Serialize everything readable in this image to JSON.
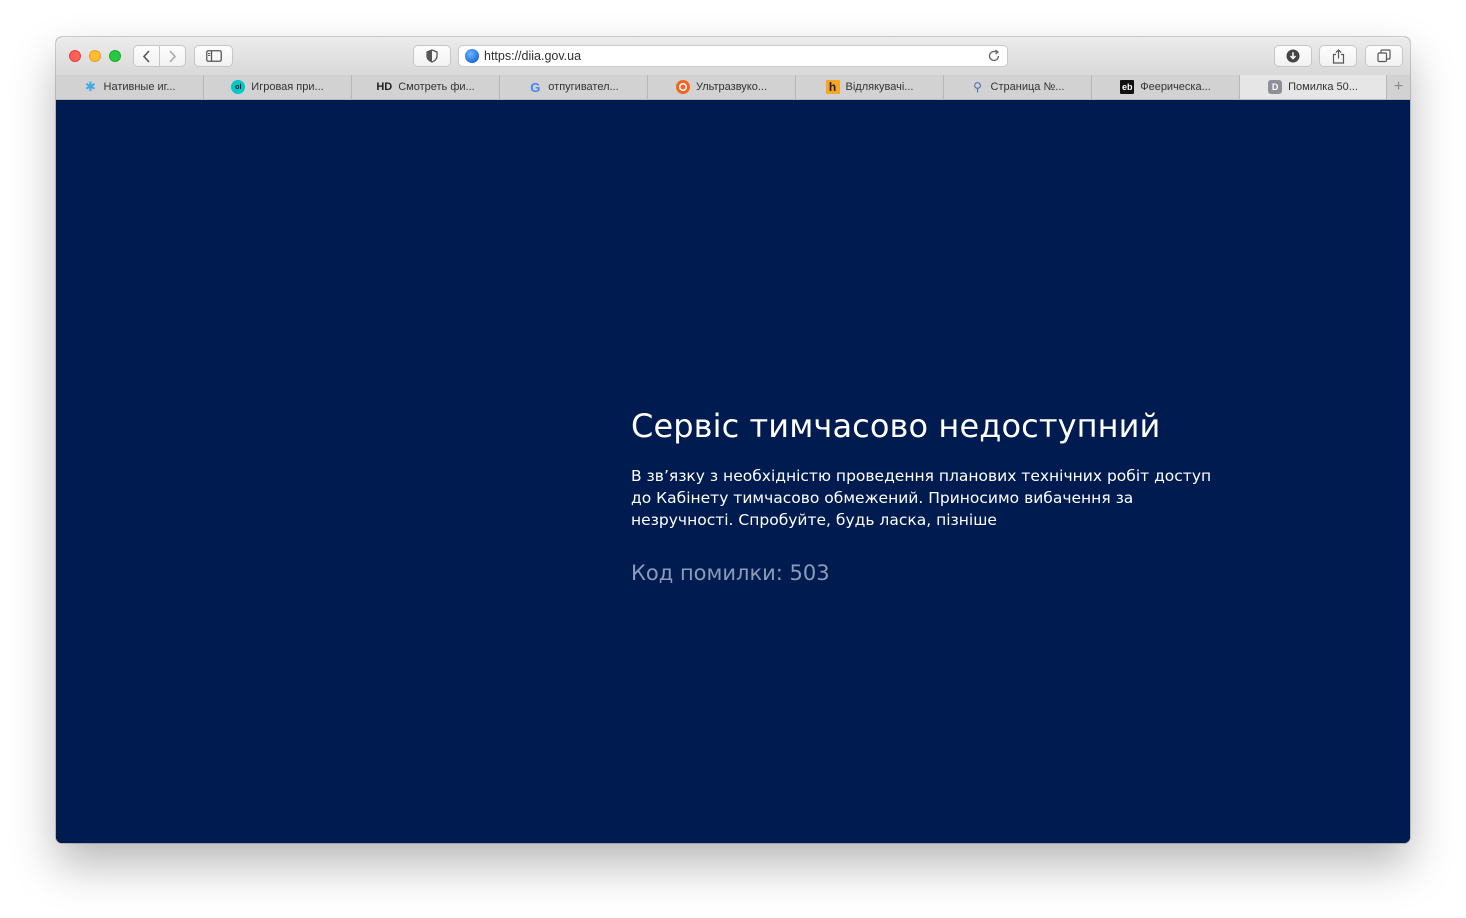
{
  "browser": {
    "url": "https://diia.gov.ua",
    "tabs": [
      {
        "label": "Нативные иг...",
        "icon": "snowflake-icon",
        "color": "#3fa7e6"
      },
      {
        "label": "Игровая при...",
        "icon": "ol-icon",
        "color": "#00c8c8"
      },
      {
        "label": "Смотреть фи...",
        "icon": "hd-icon",
        "icon_text": "HD",
        "color": "#222222"
      },
      {
        "label": "отпугивател...",
        "icon": "google-icon",
        "icon_text": "G",
        "color": "#4285f4"
      },
      {
        "label": "Ультразвуко...",
        "icon": "orange-circle-icon",
        "color": "#f26522"
      },
      {
        "label": "Відлякувачі...",
        "icon": "h-icon",
        "icon_text": "h",
        "color": "#f5a623"
      },
      {
        "label": "Страница №...",
        "icon": "dish-icon",
        "color": "#4a6fa5"
      },
      {
        "label": "Феерическа...",
        "icon": "eb-icon",
        "icon_text": "eb",
        "color": "#111111"
      },
      {
        "label": "Помилка 50...",
        "icon": "d-icon",
        "icon_text": "D",
        "color": "#8f8f99",
        "active": true
      }
    ]
  },
  "page": {
    "title": "Сервіс тимчасово недоступний",
    "message": "В зв’язку з необхідністю проведення планових технічних робіт доступ до Кабінету тимчасово обмежений. Приносимо вибачення за незручності. Спробуйте, будь ласка, пізніше",
    "error_code": "Код помилки: 503",
    "background": "#001b4f"
  }
}
